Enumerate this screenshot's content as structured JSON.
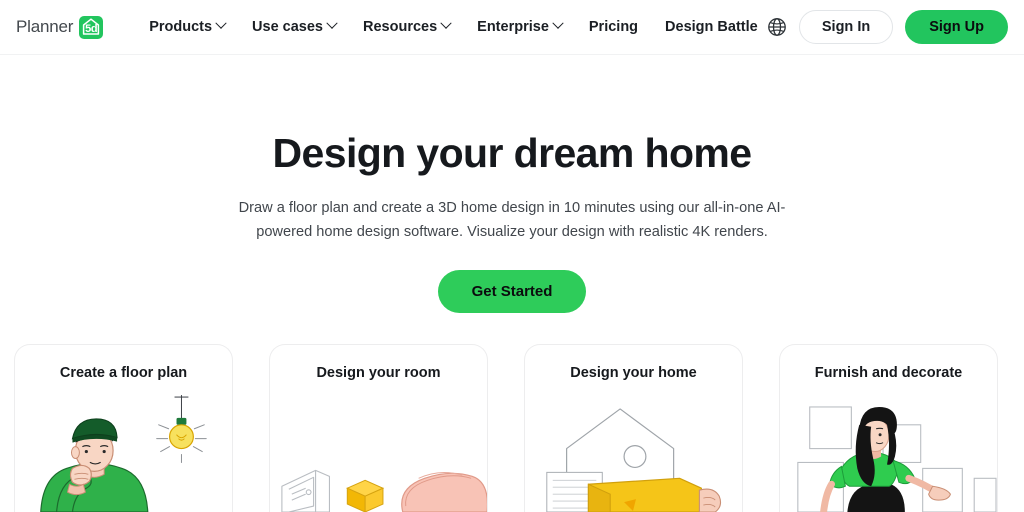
{
  "header": {
    "logo": {
      "word": "Planner",
      "badge": "5d",
      "icon": "house-icon"
    },
    "nav": [
      {
        "label": "Products",
        "has_chevron": true
      },
      {
        "label": "Use cases",
        "has_chevron": true
      },
      {
        "label": "Resources",
        "has_chevron": true
      },
      {
        "label": "Enterprise",
        "has_chevron": true
      },
      {
        "label": "Pricing",
        "has_chevron": false
      },
      {
        "label": "Design Battle",
        "has_chevron": false
      }
    ],
    "language_icon": "globe-icon",
    "sign_in_label": "Sign In",
    "sign_up_label": "Sign Up"
  },
  "hero": {
    "title": "Design your dream home",
    "subtitle": "Draw a floor plan and create a 3D home design in 10 minutes using our all-in-one AI-powered home design software. Visualize your design with realistic 4K renders.",
    "cta_label": "Get Started"
  },
  "cards": [
    {
      "title": "Create a floor plan",
      "art": "person-thinking-lightbulb-illustration"
    },
    {
      "title": "Design your room",
      "art": "isometric-room-furniture-illustration"
    },
    {
      "title": "Design your home",
      "art": "house-blueprint-box-illustration"
    },
    {
      "title": "Furnish and decorate",
      "art": "woman-picture-frames-illustration"
    }
  ],
  "colors": {
    "brand_green": "#22c55e",
    "cta_green": "#2ecc5a",
    "text_dark": "#16191d",
    "text_body": "#41464c",
    "border_light": "#ededee",
    "header_border": "#f1f2f3",
    "illustration_yellow": "#f5c518",
    "illustration_pink": "#f7bfb4",
    "illustration_skin": "#f6cdbb"
  }
}
